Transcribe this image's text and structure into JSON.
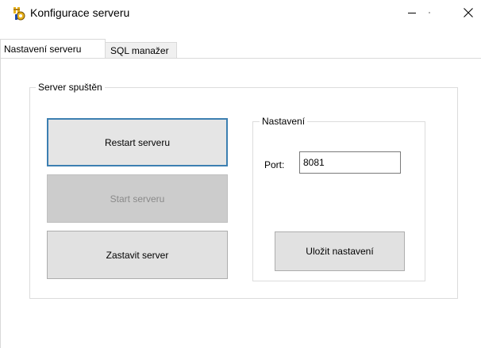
{
  "window": {
    "title": "Konfigurace serveru",
    "icon": "app-gear-icon",
    "controls": {
      "minimize": "minimize-icon",
      "maximize": "maximize-icon",
      "close": "close-icon"
    }
  },
  "tabs": [
    {
      "label": "Nastavení serveru",
      "active": true
    },
    {
      "label": "SQL manažer",
      "active": false
    }
  ],
  "server_group": {
    "label": "Server spuštěn",
    "restart_label": "Restart serveru",
    "start_label": "Start serveru",
    "stop_label": "Zastavit server"
  },
  "settings_group": {
    "label": "Nastavení",
    "port_label": "Port:",
    "port_value": "8081",
    "save_label": "Uložit nastavení"
  },
  "colors": {
    "focus_border": "#3c7fb1",
    "button_face": "#e1e1e1",
    "disabled_face": "#cccccc"
  }
}
